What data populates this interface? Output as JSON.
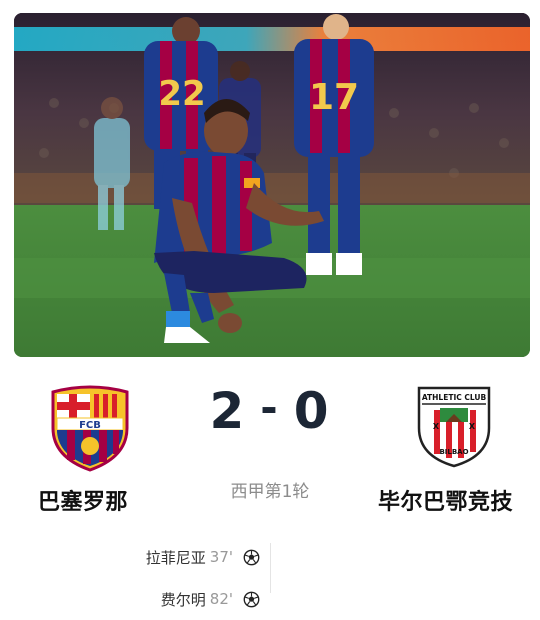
{
  "match": {
    "home_team": "巴塞罗那",
    "away_team": "毕尔巴鄂竞技",
    "home_score": "2",
    "away_score": "0",
    "separator": "-",
    "round": "西甲第1轮",
    "home_crest_text": "FCB",
    "away_crest_text_top": "ATHLETIC CLUB",
    "away_crest_text_bottom": "BILBAO"
  },
  "scorers": [
    {
      "name": "拉菲尼亚",
      "minute": "37'",
      "icon": "football-icon"
    },
    {
      "name": "费尔明",
      "minute": "82'",
      "icon": "football-icon"
    }
  ],
  "photo": {
    "player_number_left": "22",
    "player_number_right": "17",
    "description_icon": "match-photo"
  },
  "colors": {
    "barca_blue": "#1d3c8f",
    "barca_red": "#a50044",
    "athletic_red": "#d81f2a",
    "score_color": "#1c2635"
  }
}
